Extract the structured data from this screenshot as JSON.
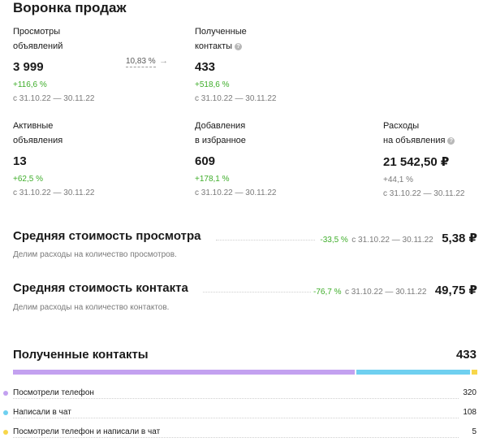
{
  "funnel": {
    "title": "Воронка продаж",
    "views": {
      "label1": "Просмотры",
      "label2": "объявлений",
      "value": "3 999",
      "change": "+116,6 %",
      "period": "с 31.10.22 — 30.11.22"
    },
    "conversion": "10,83 %",
    "contacts": {
      "label1": "Полученные",
      "label2": "контакты",
      "value": "433",
      "change": "+518,6 %",
      "period": "с 31.10.22 — 30.11.22"
    },
    "active": {
      "label1": "Активные",
      "label2": "объявления",
      "value": "13",
      "change": "+62,5 %",
      "period": "с 31.10.22 — 30.11.22"
    },
    "favorites": {
      "label1": "Добавления",
      "label2": "в избранное",
      "value": "609",
      "change": "+178,1 %",
      "period": "с 31.10.22 — 30.11.22"
    },
    "spend": {
      "label1": "Расходы",
      "label2": "на объявления",
      "value": "21 542,50 ₽",
      "change": "+44,1 %",
      "period": "с 31.10.22 — 30.11.22"
    }
  },
  "avg_view": {
    "title": "Средняя стоимость просмотра",
    "change": "-33,5 %",
    "period": "с 31.10.22 — 30.11.22",
    "value": "5,38 ₽",
    "subtitle": "Делим расходы на количество просмотров."
  },
  "avg_contact": {
    "title": "Средняя стоимость контакта",
    "change": "-76,7 %",
    "period": "с 31.10.22 — 30.11.22",
    "value": "49,75 ₽",
    "subtitle": "Делим расходы на количество контактов."
  },
  "received": {
    "title": "Полученные контакты",
    "total": "433",
    "items": [
      {
        "label": "Посмотрели телефон",
        "value": "320",
        "color": "#c3a1f0"
      },
      {
        "label": "Написали в чат",
        "value": "108",
        "color": "#6fd0f0"
      },
      {
        "label": "Посмотрели телефон и написали в чат",
        "value": "5",
        "color": "#f7d64a"
      }
    ]
  }
}
